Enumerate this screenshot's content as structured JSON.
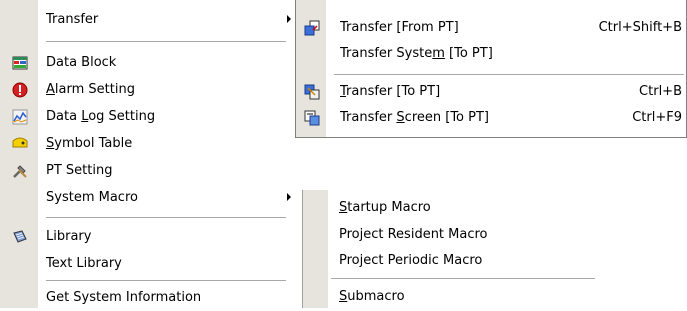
{
  "main_menu": {
    "transfer": "Transfer",
    "data_block": "Data Block",
    "alarm_pre": "",
    "alarm_key": "A",
    "alarm_post": "larm Setting",
    "datalog_pre": "Data ",
    "datalog_key": "L",
    "datalog_post": "og Setting",
    "symbol_pre": "",
    "symbol_key": "S",
    "symbol_post": "ymbol Table",
    "pt_setting": "PT Setting",
    "system_macro": "System Macro",
    "library": "Library",
    "text_library": "Text Library",
    "get_system_info": "Get System Information"
  },
  "transfer_submenu": {
    "from_pt": "Transfer [From PT]",
    "from_pt_shortcut": "Ctrl+Shift+B",
    "system_pre": "Transfer Syste",
    "system_key": "m",
    "system_post": " [To PT]",
    "to_pt_pre": "",
    "to_pt_key": "T",
    "to_pt_post": "ransfer [To PT]",
    "to_pt_shortcut": "Ctrl+B",
    "screen_pre": "Transfer ",
    "screen_key": "S",
    "screen_post": "creen [To PT]",
    "screen_shortcut": "Ctrl+F9"
  },
  "macro_submenu": {
    "startup_pre": "",
    "startup_key": "S",
    "startup_post": "tartup Macro",
    "resident": "Project Resident Macro",
    "periodic": "Project Periodic Macro",
    "sub_pre": "",
    "sub_key": "S",
    "sub_post": "ubmacro"
  },
  "icons": {
    "data_block": "data-block-icon",
    "alarm": "alarm-icon",
    "data_log": "data-log-icon",
    "symbol_table": "symbol-table-icon",
    "pt_setting": "pt-setting-icon",
    "library": "library-icon",
    "transfer_from": "transfer-from-pt-icon",
    "transfer_to": "transfer-to-pt-icon",
    "transfer_screen": "transfer-screen-icon"
  }
}
